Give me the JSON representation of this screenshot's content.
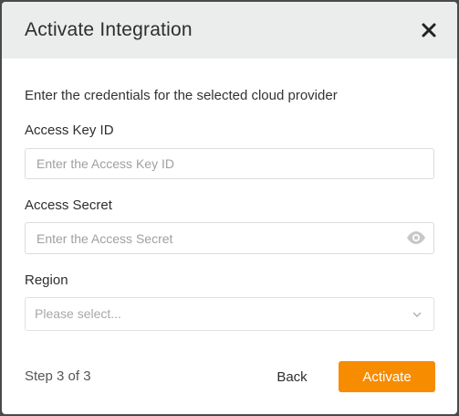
{
  "dialog": {
    "title": "Activate Integration",
    "close_icon": "close-icon"
  },
  "body": {
    "intro": "Enter the credentials for the selected cloud provider",
    "fields": {
      "access_key": {
        "label": "Access Key ID",
        "value": "",
        "placeholder": "Enter the Access Key ID"
      },
      "access_secret": {
        "label": "Access Secret",
        "value": "",
        "placeholder": "Enter the Access Secret",
        "toggle_icon": "eye-icon"
      },
      "region": {
        "label": "Region",
        "selected": "",
        "placeholder": "Please select...",
        "icon": "chevron-down-icon"
      }
    }
  },
  "footer": {
    "step": "Step 3 of 3",
    "back_label": "Back",
    "activate_label": "Activate"
  },
  "colors": {
    "header_bg": "#ebecec",
    "accent": "#f78c00",
    "backdrop": "#4a4a4a"
  }
}
